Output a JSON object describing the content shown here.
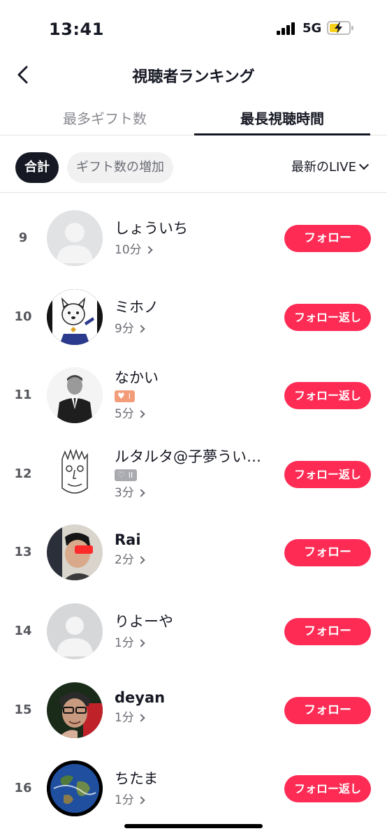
{
  "status_bar": {
    "time": "13:41",
    "network": "5G"
  },
  "header": {
    "title": "視聴者ランキング"
  },
  "tabs": [
    {
      "label": "最多ギフト数"
    },
    {
      "label": "最長視聴時間"
    }
  ],
  "filters": {
    "total_label": "合計",
    "gift_increase_label": "ギフト数の増加",
    "sort_label": "最新のLIVE"
  },
  "viewers": [
    {
      "rank": "9",
      "name": "しょういち",
      "duration": "10分",
      "button": "フォロー",
      "avatar": "default-avatar-icon"
    },
    {
      "rank": "10",
      "name": "ミホノ",
      "duration": "9分",
      "button": "フォロー返し",
      "avatar": "dog-illustration-avatar"
    },
    {
      "rank": "11",
      "name": "なかい",
      "badge": "I",
      "duration": "5分",
      "button": "フォロー返し",
      "avatar": "man-in-suit-avatar"
    },
    {
      "rank": "12",
      "name": "ルタルタ@子夢うい…",
      "badge": "II",
      "duration": "3分",
      "button": "フォロー返し",
      "avatar": "face-sketch-avatar"
    },
    {
      "rank": "13",
      "name": "Rai",
      "duration": "2分",
      "button": "フォロー",
      "avatar": "person-photo-avatar"
    },
    {
      "rank": "14",
      "name": "りよーや",
      "duration": "1分",
      "button": "フォロー",
      "avatar": "default-avatar-icon"
    },
    {
      "rank": "15",
      "name": "deyan",
      "duration": "1分",
      "button": "フォロー",
      "avatar": "selfie-photo-avatar"
    },
    {
      "rank": "16",
      "name": "ちたま",
      "duration": "1分",
      "button": "フォロー返し",
      "avatar": "earth-avatar"
    }
  ],
  "colors": {
    "accent": "#fe2c55",
    "text": "#161823",
    "muted": "#6b6d74"
  }
}
